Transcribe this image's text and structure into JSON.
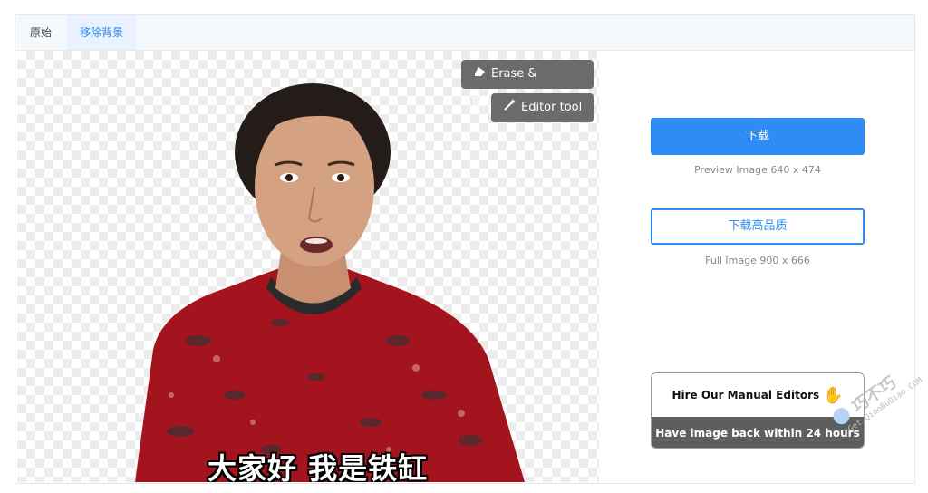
{
  "tabs": [
    {
      "label": "原始",
      "active": false
    },
    {
      "label": "移除背景",
      "active": true
    }
  ],
  "image": {
    "subtitle": "大家好 我是铁缸"
  },
  "overlay_buttons": {
    "erase_restore": "Erase & Restore",
    "editor_tool": "Editor tool"
  },
  "download": {
    "label": "下载",
    "caption": "Preview Image  640 x 474"
  },
  "download_hq": {
    "label": "下载高品质",
    "caption": "Full Image  900 x 666"
  },
  "hire": {
    "title": "Hire Our Manual Editors",
    "subtitle": "Have image back within 24 hours"
  },
  "watermark": {
    "text": "巧不巧",
    "url": "Get.QiaoBuQiao.COM"
  },
  "colors": {
    "accent": "#2d8cf5",
    "overlay_button": "#6b6b6b",
    "hire_bar": "#5e5e5e"
  },
  "icons": {
    "erase": "eraser-icon",
    "editor": "magic-wand-icon",
    "hire": "waving-hand-icon"
  }
}
